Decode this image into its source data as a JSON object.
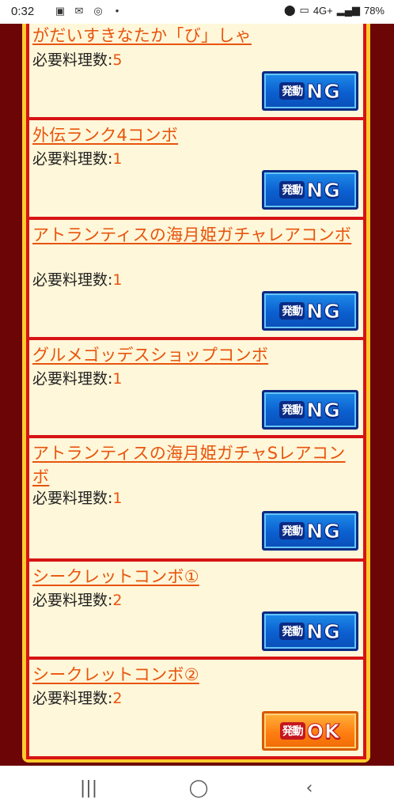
{
  "status": {
    "time": "0:32",
    "battery": "78%",
    "network": "4G+"
  },
  "combos": [
    {
      "name": "がだいすきなたか「び」しゃ",
      "req_label": "必要料理数:",
      "req_value": "5",
      "button": {
        "kan": "発動",
        "big": "NG",
        "state": "ng"
      }
    },
    {
      "name": "外伝ランク4コンボ",
      "req_label": "必要料理数:",
      "req_value": "1",
      "button": {
        "kan": "発動",
        "big": "NG",
        "state": "ng"
      }
    },
    {
      "name": "アトランティスの海月姫ガチャレアコンボ",
      "req_label": "必要料理数:",
      "req_value": "1",
      "button": {
        "kan": "発動",
        "big": "NG",
        "state": "ng"
      }
    },
    {
      "name": "グルメゴッデスショップコンボ",
      "req_label": "必要料理数:",
      "req_value": "1",
      "button": {
        "kan": "発動",
        "big": "NG",
        "state": "ng"
      }
    },
    {
      "name": "アトランティスの海月姫ガチャSレアコンボ",
      "req_label": "必要料理数:",
      "req_value": "1",
      "button": {
        "kan": "発動",
        "big": "NG",
        "state": "ng"
      }
    },
    {
      "name": "シークレットコンボ①",
      "req_label": "必要料理数:",
      "req_value": "2",
      "button": {
        "kan": "発動",
        "big": "NG",
        "state": "ng"
      }
    },
    {
      "name": "シークレットコンボ②",
      "req_label": "必要料理数:",
      "req_value": "2",
      "button": {
        "kan": "発動",
        "big": "OK",
        "state": "ok"
      }
    }
  ],
  "colors": {
    "background": "#6b0506",
    "frame": "#ffca2c",
    "card": "#fff7d9",
    "link": "#e8540d",
    "ng_button": "#0b5fd0",
    "ok_button": "#ff7f12"
  }
}
